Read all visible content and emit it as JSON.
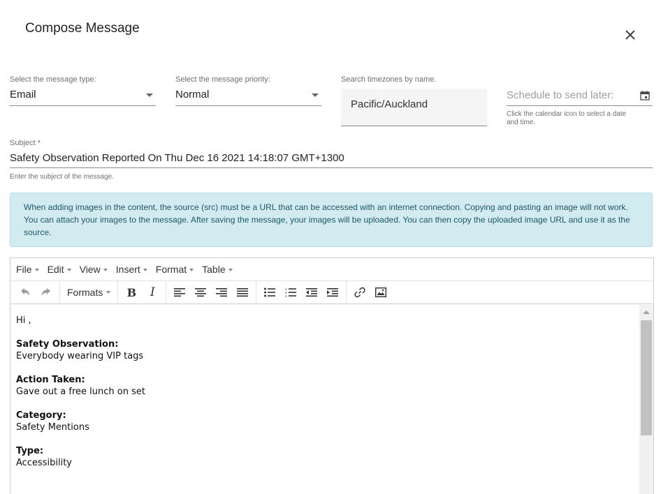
{
  "dialog": {
    "title": "Compose Message"
  },
  "message_type": {
    "label": "Select the message type:",
    "value": "Email"
  },
  "message_priority": {
    "label": "Select the message priority:",
    "value": "Normal"
  },
  "timezone": {
    "label": "Search timezones by name.",
    "value": "Pacific/Auckland"
  },
  "schedule": {
    "placeholder": "Schedule to send later:",
    "hint_line1": "Click the calendar icon to select a date",
    "hint_line2": "and time."
  },
  "subject": {
    "label": "Subject *",
    "value": "Safety Observation Reported On Thu Dec 16 2021 14:18:07 GMT+1300",
    "hint": "Enter the subject of the message."
  },
  "notice": {
    "line1": "When adding images in the content, the source (src) must be a URL that can be accessed with an internet connection. Copying and pasting an image will not work.",
    "line2": "You can attach your images to the message. After saving the message, your images will be uploaded. You can then copy the uploaded image URL and use it as the",
    "line3": "source."
  },
  "editor": {
    "menus": [
      "File",
      "Edit",
      "View",
      "Insert",
      "Format",
      "Table"
    ],
    "formats_label": "Formats",
    "icons": {
      "undo": "undo-icon",
      "redo": "redo-icon",
      "bold": "bold-icon",
      "italic": "italic-icon",
      "align_left": "align-left-icon",
      "align_center": "align-center-icon",
      "align_right": "align-right-icon",
      "justify": "align-justify-icon",
      "bullet_list": "bullet-list-icon",
      "numbered_list": "numbered-list-icon",
      "outdent": "outdent-icon",
      "indent": "indent-icon",
      "link": "link-icon",
      "image": "image-icon"
    },
    "content": {
      "greeting": "Hi ,",
      "obs_label": "Safety Observation:",
      "obs_value": "Everybody wearing VIP tags",
      "action_label": "Action Taken:",
      "action_value": "Gave out a free lunch on set",
      "category_label": "Category:",
      "category_value": "Safety Mentions",
      "type_label": "Type:",
      "type_value": "Accessibility"
    }
  },
  "colors": {
    "notice_bg": "#d1ebf0",
    "notice_text": "#1f5766",
    "underline": "#8a8a8a"
  }
}
